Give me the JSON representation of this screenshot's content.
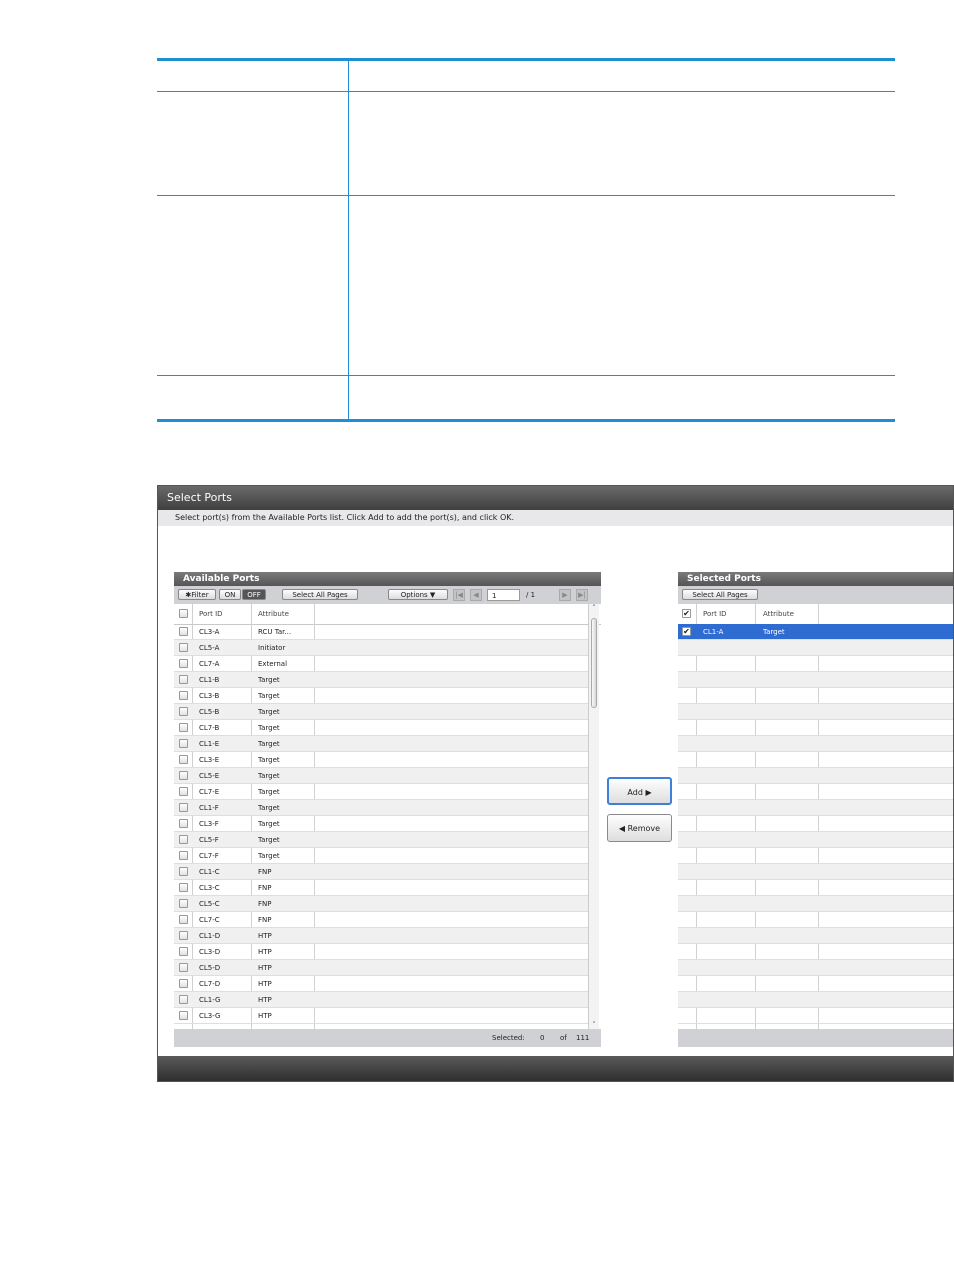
{
  "dialog": {
    "title": "Select Ports",
    "instruction": "Select port(s) from the Available Ports list. Click Add to add the port(s), and click OK."
  },
  "available": {
    "title": "Available Ports",
    "filter_label": "✱Filter",
    "on_label": "ON",
    "off_label": "OFF",
    "select_all_label": "Select All Pages",
    "options_label": "Options ▼",
    "page_value": "1",
    "page_total": "/ 1",
    "columns": {
      "port_id": "Port ID",
      "attribute": "Attribute"
    },
    "rows": [
      {
        "port_id": "CL3-A",
        "attribute": "RCU Tar..."
      },
      {
        "port_id": "CL5-A",
        "attribute": "Initiator"
      },
      {
        "port_id": "CL7-A",
        "attribute": "External"
      },
      {
        "port_id": "CL1-B",
        "attribute": "Target"
      },
      {
        "port_id": "CL3-B",
        "attribute": "Target"
      },
      {
        "port_id": "CL5-B",
        "attribute": "Target"
      },
      {
        "port_id": "CL7-B",
        "attribute": "Target"
      },
      {
        "port_id": "CL1-E",
        "attribute": "Target"
      },
      {
        "port_id": "CL3-E",
        "attribute": "Target"
      },
      {
        "port_id": "CL5-E",
        "attribute": "Target"
      },
      {
        "port_id": "CL7-E",
        "attribute": "Target"
      },
      {
        "port_id": "CL1-F",
        "attribute": "Target"
      },
      {
        "port_id": "CL3-F",
        "attribute": "Target"
      },
      {
        "port_id": "CL5-F",
        "attribute": "Target"
      },
      {
        "port_id": "CL7-F",
        "attribute": "Target"
      },
      {
        "port_id": "CL1-C",
        "attribute": "FNP"
      },
      {
        "port_id": "CL3-C",
        "attribute": "FNP"
      },
      {
        "port_id": "CL5-C",
        "attribute": "FNP"
      },
      {
        "port_id": "CL7-C",
        "attribute": "FNP"
      },
      {
        "port_id": "CL1-D",
        "attribute": "HTP"
      },
      {
        "port_id": "CL3-D",
        "attribute": "HTP"
      },
      {
        "port_id": "CL5-D",
        "attribute": "HTP"
      },
      {
        "port_id": "CL7-D",
        "attribute": "HTP"
      },
      {
        "port_id": "CL1-G",
        "attribute": "HTP"
      },
      {
        "port_id": "CL3-G",
        "attribute": "HTP"
      }
    ],
    "status": {
      "selected_label": "Selected:",
      "selected_count": "0",
      "of_label": "of",
      "total": "111"
    }
  },
  "buttons": {
    "add": "Add ▶",
    "remove": "◀ Remove"
  },
  "selected": {
    "title": "Selected Ports",
    "select_all_label": "Select All Pages",
    "columns": {
      "port_id": "Port ID",
      "attribute": "Attribute"
    },
    "rows": [
      {
        "port_id": "CL1-A",
        "attribute": "Target",
        "checked": true
      }
    ]
  }
}
